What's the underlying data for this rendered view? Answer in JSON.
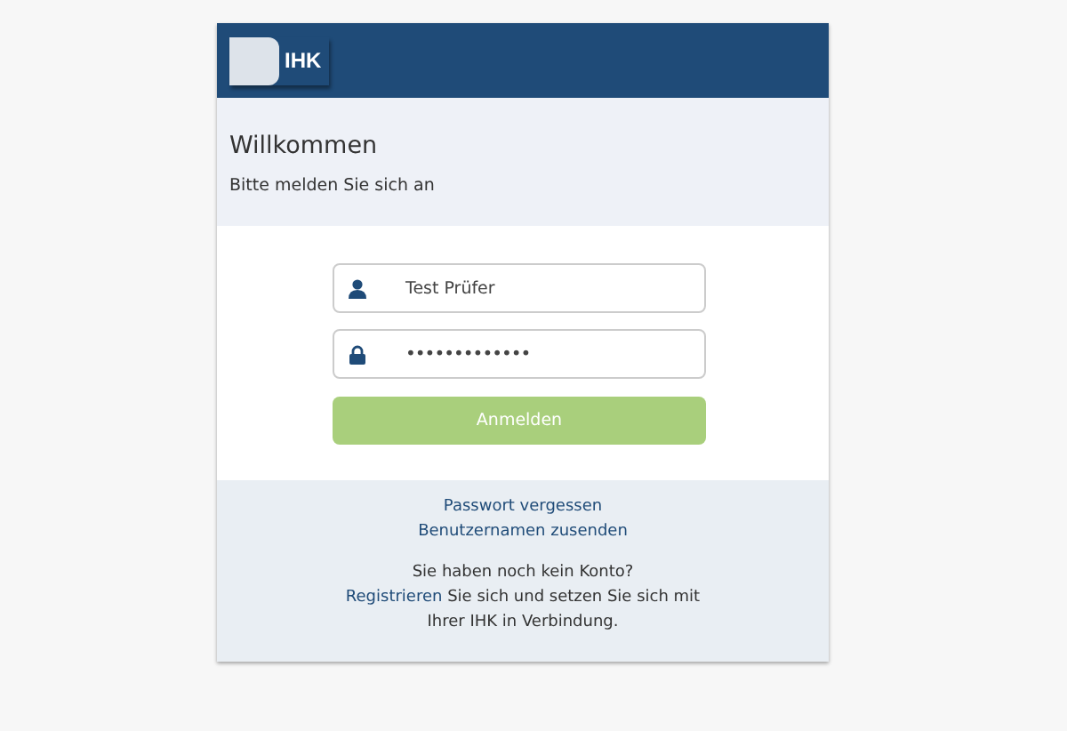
{
  "header": {
    "logo": "IHK"
  },
  "welcome": {
    "title": "Willkommen",
    "subtitle": "Bitte melden Sie sich an"
  },
  "form": {
    "username": {
      "value": "Test Prüfer"
    },
    "password": {
      "value": "•••••••••••••"
    },
    "submit": {
      "label": "Anmelden",
      "disabled": true
    }
  },
  "footer": {
    "links": [
      "Passwort vergessen",
      "Benutzernamen zusenden"
    ],
    "question": "Sie haben noch kein Konto?",
    "register_link": "Registrieren",
    "register_text": "Sie sich und setzen Sie sich mit Ihrer IHK in Verbindung."
  }
}
